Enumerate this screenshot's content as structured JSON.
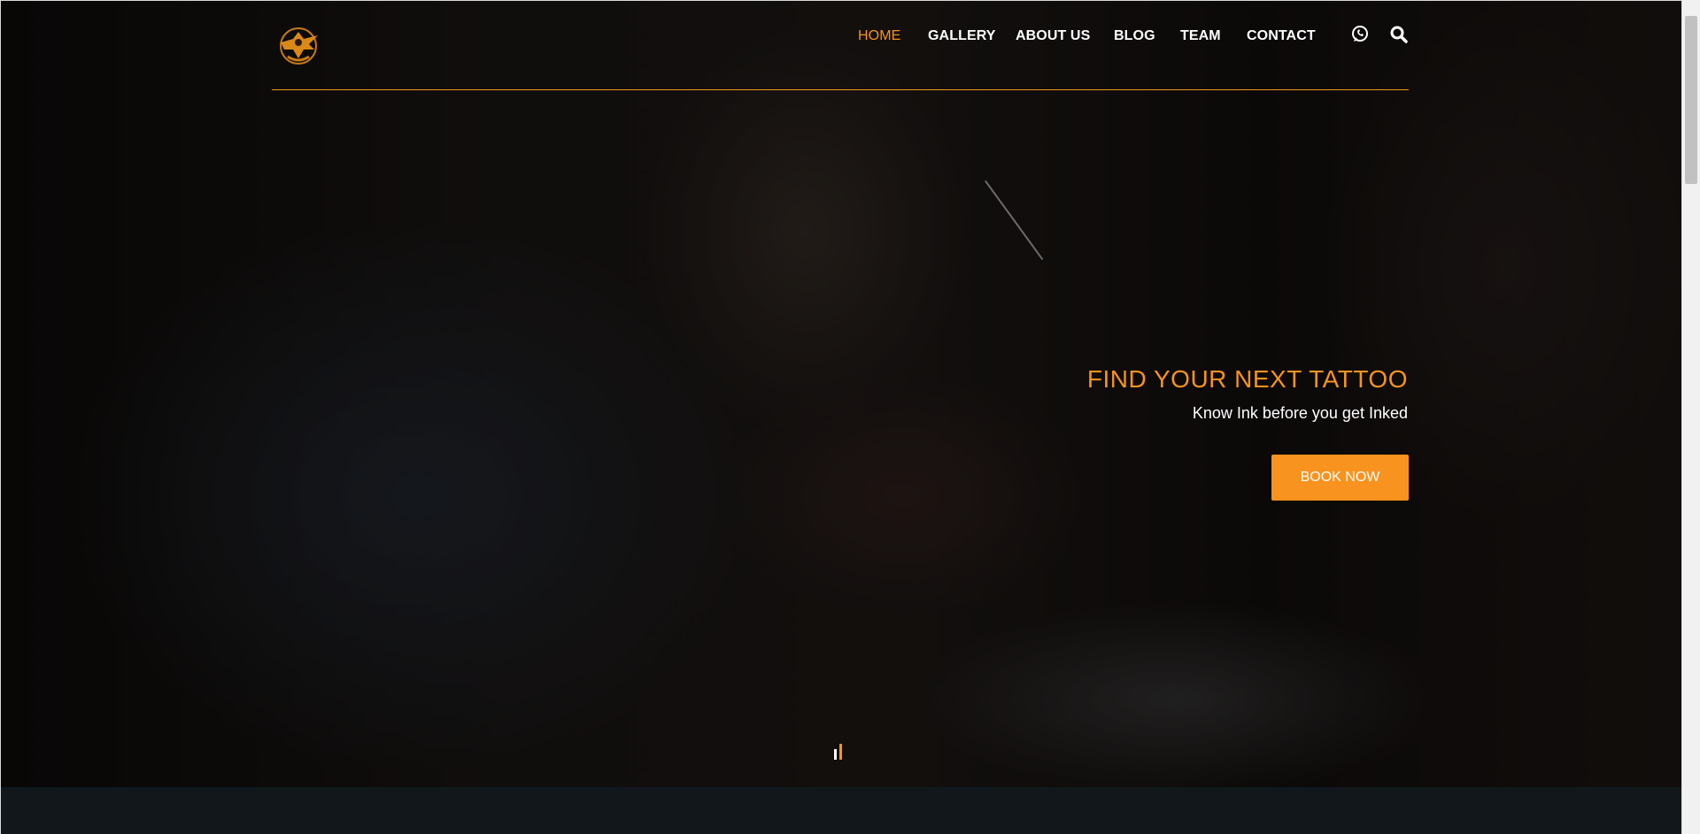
{
  "header": {
    "logo_icon": "eagle-emblem-logo",
    "nav": [
      {
        "label": "HOME",
        "active": true
      },
      {
        "label": "GALLERY",
        "active": false
      },
      {
        "label": "ABOUT US",
        "active": false
      },
      {
        "label": "BLOG",
        "active": false
      },
      {
        "label": "TEAM",
        "active": false
      },
      {
        "label": "CONTACT",
        "active": false
      }
    ],
    "icons": [
      "whatsapp-icon",
      "search-icon"
    ]
  },
  "hero": {
    "title": "FIND YOUR NEXT TATTOO",
    "subtitle": "Know Ink before you get Inked",
    "cta_label": "BOOK NOW"
  },
  "colors": {
    "accent": "#f7931e",
    "nav_text": "#ffffff",
    "bottom_band": "#11171b"
  }
}
